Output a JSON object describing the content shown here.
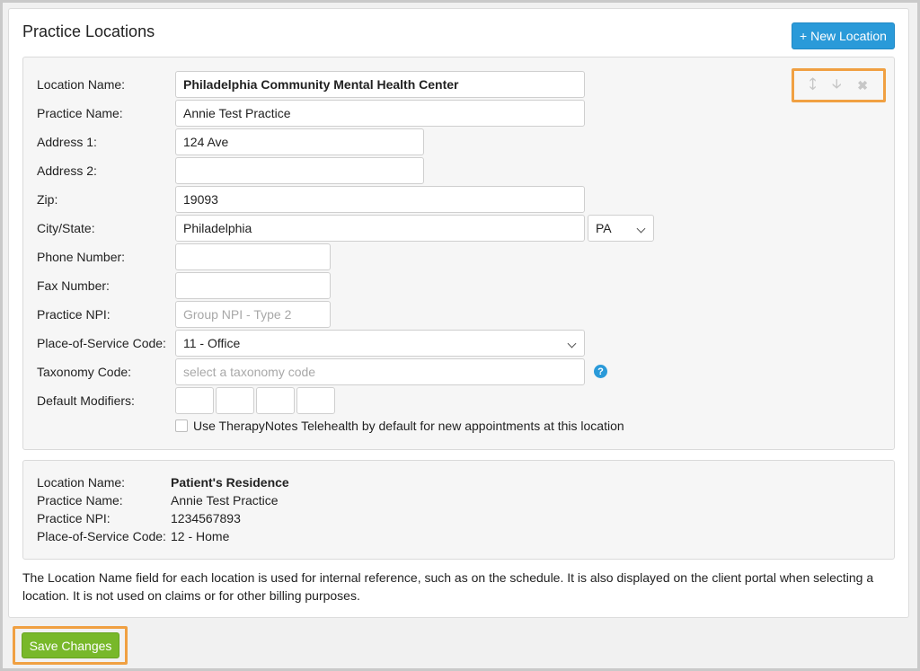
{
  "header": {
    "title": "Practice Locations",
    "new_location_label": "+ New Location"
  },
  "card_controls": {
    "up_icon": "arrow-up-icon",
    "down_icon": "arrow-down-icon",
    "remove_icon": "close-icon"
  },
  "form": {
    "labels": {
      "location_name": "Location Name:",
      "practice_name": "Practice Name:",
      "address1": "Address 1:",
      "address2": "Address 2:",
      "zip": "Zip:",
      "city_state": "City/State:",
      "phone": "Phone Number:",
      "fax": "Fax Number:",
      "npi": "Practice NPI:",
      "pos": "Place-of-Service Code:",
      "taxonomy": "Taxonomy Code:",
      "modifiers": "Default Modifiers:"
    },
    "values": {
      "location_name": "Philadelphia Community Mental Health Center",
      "practice_name": "Annie Test Practice",
      "address1": "124 Ave",
      "address2": "",
      "zip": "19093",
      "city": "Philadelphia",
      "state": "PA",
      "phone": "",
      "fax": "",
      "npi": "",
      "pos": "11 - Office",
      "taxonomy": ""
    },
    "placeholders": {
      "npi": "Group NPI - Type 2",
      "taxonomy": "select a taxonomy code"
    },
    "telehealth_checked": false,
    "telehealth_label": "Use TherapyNotes Telehealth by default for new appointments at this location",
    "help_glyph": "?"
  },
  "summary": {
    "labels": {
      "location_name": "Location Name:",
      "practice_name": "Practice Name:",
      "npi": "Practice NPI:",
      "pos": "Place-of-Service Code:"
    },
    "values": {
      "location_name": "Patient's Residence",
      "practice_name": "Annie Test Practice",
      "npi": "1234567893",
      "pos": "12 - Home"
    }
  },
  "note": "The Location Name field for each location is used for internal reference, such as on the schedule. It is also displayed on the client portal when selecting a location. It is not used on claims or for other billing purposes.",
  "footer": {
    "save_label": "Save Changes"
  },
  "colors": {
    "primary": "#2a9ad9",
    "save": "#78b82a",
    "highlight": "#f0a042"
  }
}
